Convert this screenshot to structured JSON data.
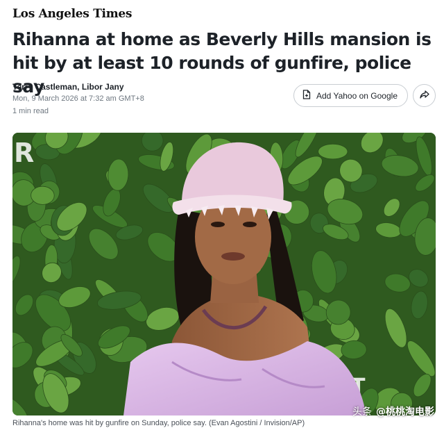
{
  "masthead": "Los Angeles Times",
  "headline": "Rihanna at home as Beverly Hills mansion is hit by at least 10 rounds of gunfire, police say",
  "byline": {
    "authors": "Terry Castleman, Libor Jany",
    "timestamp": "Mon, 9 March 2026 at 7:32 am GMT+8",
    "read_time": "1 min read"
  },
  "actions": {
    "add_source_label": "Add Yahoo on Google",
    "add_source_icon": "plus-document-icon",
    "share_icon": "share-arrow-icon"
  },
  "photo": {
    "caption": "Rihanna's home was hit by gunfire on Sunday, police say. (Evan Agostini / Invision/AP)"
  },
  "watermark": {
    "prefix": "头条",
    "handle": "@桃桃淘电影"
  },
  "colors": {
    "text": "#1d2228",
    "meta": "#6e7780",
    "leaf_dark": "#2f5a1f",
    "leaf_light": "#5d9a3a",
    "dress": "#d8b4e2"
  }
}
